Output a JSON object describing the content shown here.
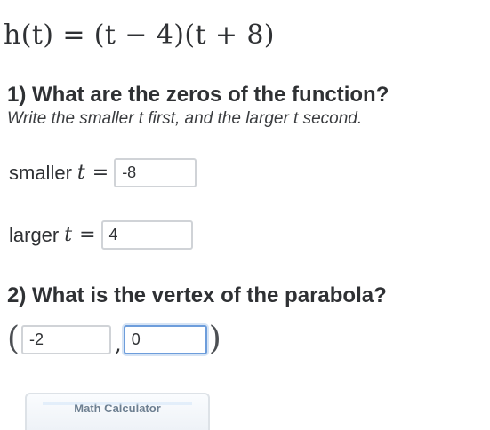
{
  "problem": {
    "function_definition": "h(t) = (t − 4)(t + 8)"
  },
  "question_1": {
    "heading": "1) What are the zeros of the function?",
    "instruction": "Write the smaller t first, and the larger t second.",
    "smaller": {
      "label": "smaller",
      "variable": "t",
      "equals": "=",
      "value": "-8"
    },
    "larger": {
      "label": "larger",
      "variable": "t",
      "equals": "=",
      "value": "4"
    }
  },
  "question_2": {
    "heading": "2) What is the vertex of the parabola?",
    "open_paren": "(",
    "comma": ",",
    "close_paren": ")",
    "x_value": "-2",
    "y_value": "0"
  },
  "calculator_button": {
    "label": "Math Calculator"
  },
  "colors": {
    "text": "#2f3134",
    "input_border": "#d0d3d7",
    "focused_input_border": "#6d9ddb"
  }
}
